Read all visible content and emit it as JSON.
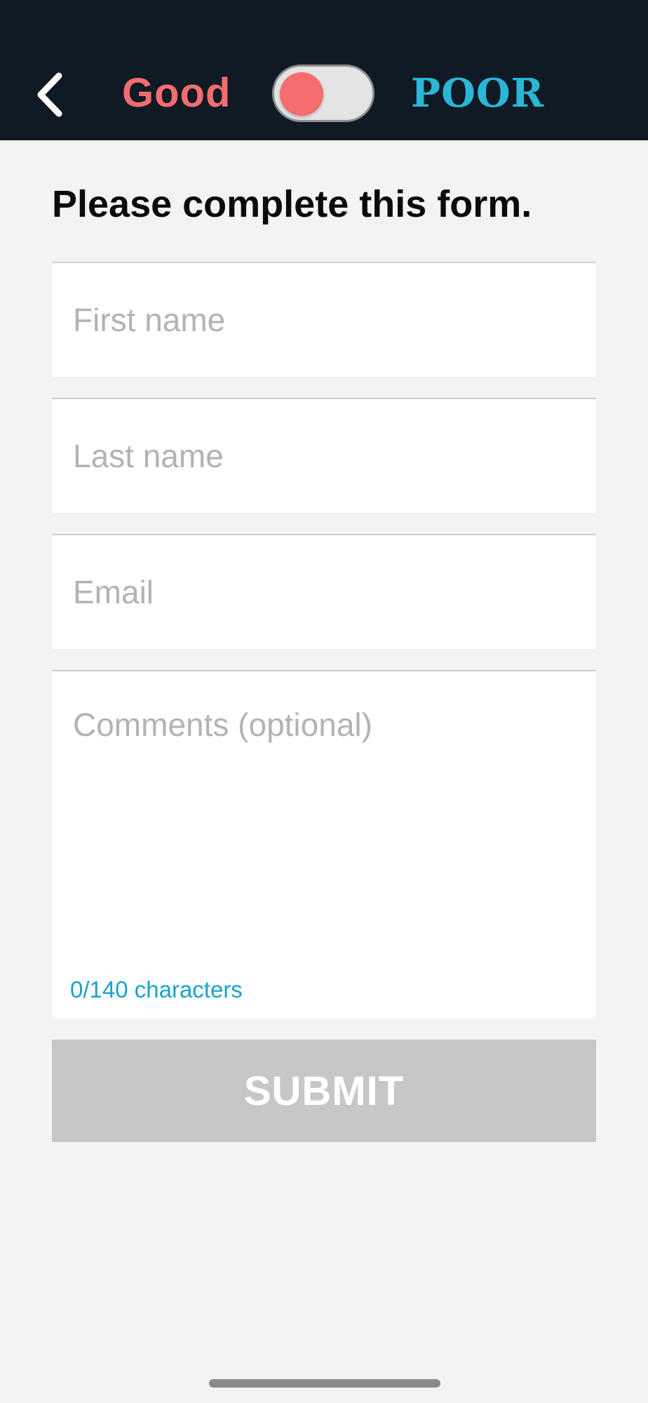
{
  "header": {
    "back_icon": "chevron-left-icon",
    "left_label": "Good",
    "right_label": "POOR",
    "toggle_state": "left",
    "colors": {
      "background": "#0f1a24",
      "good": "#f56d6f",
      "poor": "#2bb6d6"
    }
  },
  "form": {
    "title": "Please complete this form.",
    "first_name": {
      "placeholder": "First name",
      "value": ""
    },
    "last_name": {
      "placeholder": "Last name",
      "value": ""
    },
    "email": {
      "placeholder": "Email",
      "value": ""
    },
    "comments": {
      "placeholder": "Comments (optional)",
      "value": ""
    },
    "char_count": "0/140 characters",
    "submit_label": "SUBMIT"
  },
  "colors": {
    "page_background": "#f3f3f3",
    "submit_disabled": "#c7c7c7",
    "counter": "#1aa3c7"
  }
}
